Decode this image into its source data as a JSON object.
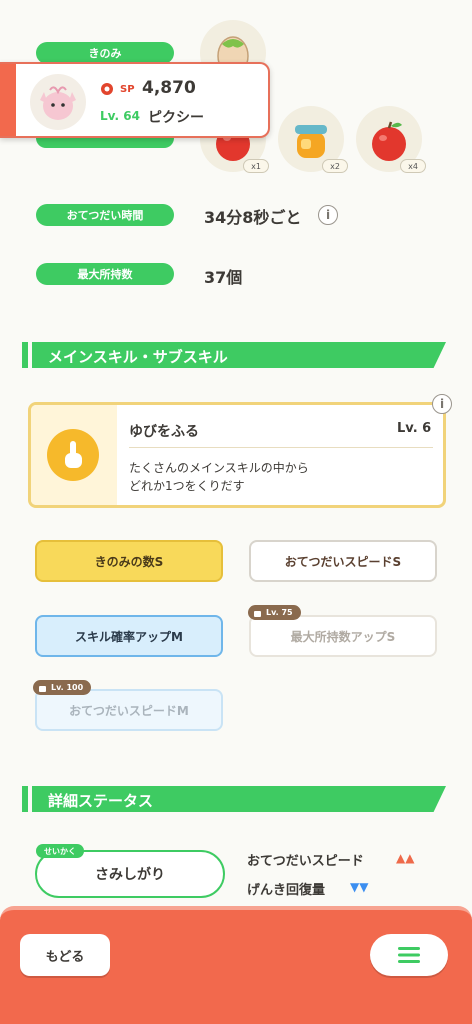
{
  "ingredient": {
    "label": "きのみ",
    "items": [
      {
        "name": "apple",
        "count": "x1"
      },
      {
        "name": "honey",
        "count": "x2"
      },
      {
        "name": "apple",
        "count": "x4"
      }
    ]
  },
  "pokemon_card": {
    "sp_label": "SP",
    "sp_value": "4,870",
    "level": "Lv. 64",
    "name": "ピクシー"
  },
  "help_time": {
    "label": "おてつだい時間",
    "value": "34分8秒ごと"
  },
  "max_carry": {
    "label": "最大所持数",
    "value": "37個"
  },
  "skills_section": {
    "title": "メインスキル・サブスキル"
  },
  "main_skill": {
    "name": "ゆびをふる",
    "level": "Lv. 6",
    "description_line1": "たくさんのメインスキルの中から",
    "description_line2": "どれか1つをくりだす"
  },
  "sub_skills": [
    {
      "label": "きのみの数S",
      "state": "gold"
    },
    {
      "label": "おてつだいスピードS",
      "state": "white"
    },
    {
      "label": "スキル確率アップM",
      "state": "blue"
    },
    {
      "label": "最大所持数アップS",
      "state": "locked",
      "lock_level": "Lv. 75"
    },
    {
      "label": "おてつだいスピードM",
      "state": "locked",
      "lock_level": "Lv. 100"
    }
  ],
  "detail_section": {
    "title": "詳細ステータス"
  },
  "nature": {
    "tag": "せいかく",
    "value": "さみしがり",
    "up_label": "おてつだいスピード",
    "up_marks": "▲▲",
    "down_label": "げんき回復量",
    "down_marks": "▼▼"
  },
  "footer": {
    "back_label": "もどる"
  },
  "colors": {
    "green": "#3ecb62",
    "footer": "#f2694d",
    "up": "#ee6a4a",
    "down": "#3b8ef0"
  }
}
